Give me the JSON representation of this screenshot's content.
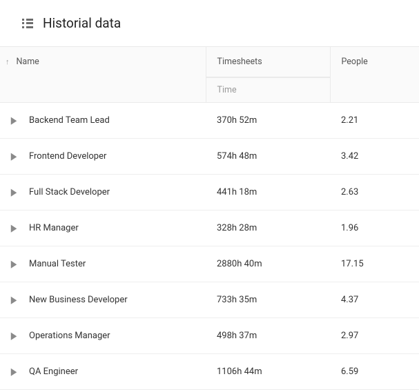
{
  "header": {
    "title": "Historial data"
  },
  "table": {
    "columns": {
      "name": "Name",
      "timesheets": "Timesheets",
      "time_sub": "Time",
      "people": "People"
    },
    "rows": [
      {
        "name": "Backend Team Lead",
        "time": "370h 52m",
        "people": "2.21"
      },
      {
        "name": "Frontend Developer",
        "time": "574h 48m",
        "people": "3.42"
      },
      {
        "name": "Full Stack Developer",
        "time": "441h 18m",
        "people": "2.63"
      },
      {
        "name": "HR Manager",
        "time": "328h 28m",
        "people": "1.96"
      },
      {
        "name": "Manual Tester",
        "time": "2880h 40m",
        "people": "17.15"
      },
      {
        "name": "New Business Developer",
        "time": "733h 35m",
        "people": "4.37"
      },
      {
        "name": "Operations Manager",
        "time": "498h 37m",
        "people": "2.97"
      },
      {
        "name": "QA Engineer",
        "time": "1106h 44m",
        "people": "6.59"
      }
    ]
  }
}
